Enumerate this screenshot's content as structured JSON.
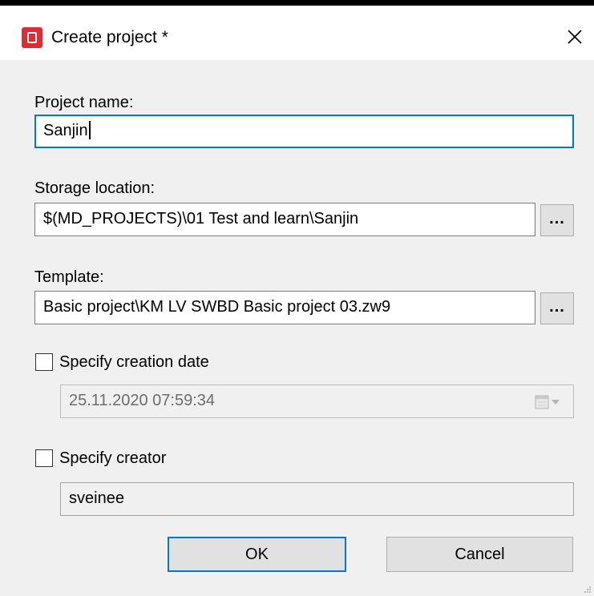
{
  "window": {
    "title": "Create project *",
    "close_icon": "close-icon"
  },
  "form": {
    "project_name": {
      "label": "Project name:",
      "value": "Sanjin"
    },
    "storage_location": {
      "label": "Storage location:",
      "value": "$(MD_PROJECTS)\\01 Test and learn\\Sanjin",
      "browse_label": "..."
    },
    "template": {
      "label": "Template:",
      "value": "Basic project\\KM LV SWBD Basic project 03.zw9",
      "browse_label": "..."
    },
    "creation_date": {
      "checkbox_label": "Specify creation date",
      "checked": false,
      "value": "25.11.2020 07:59:34",
      "picker_icon": "calendar-dropdown-icon"
    },
    "creator": {
      "checkbox_label": "Specify creator",
      "checked": false,
      "value": "sveinee"
    }
  },
  "buttons": {
    "ok_label": "OK",
    "cancel_label": "Cancel"
  },
  "colors": {
    "app_icon": "#e02b35",
    "focus_border": "#0078d7",
    "dialog_background": "#f0f0f0"
  }
}
